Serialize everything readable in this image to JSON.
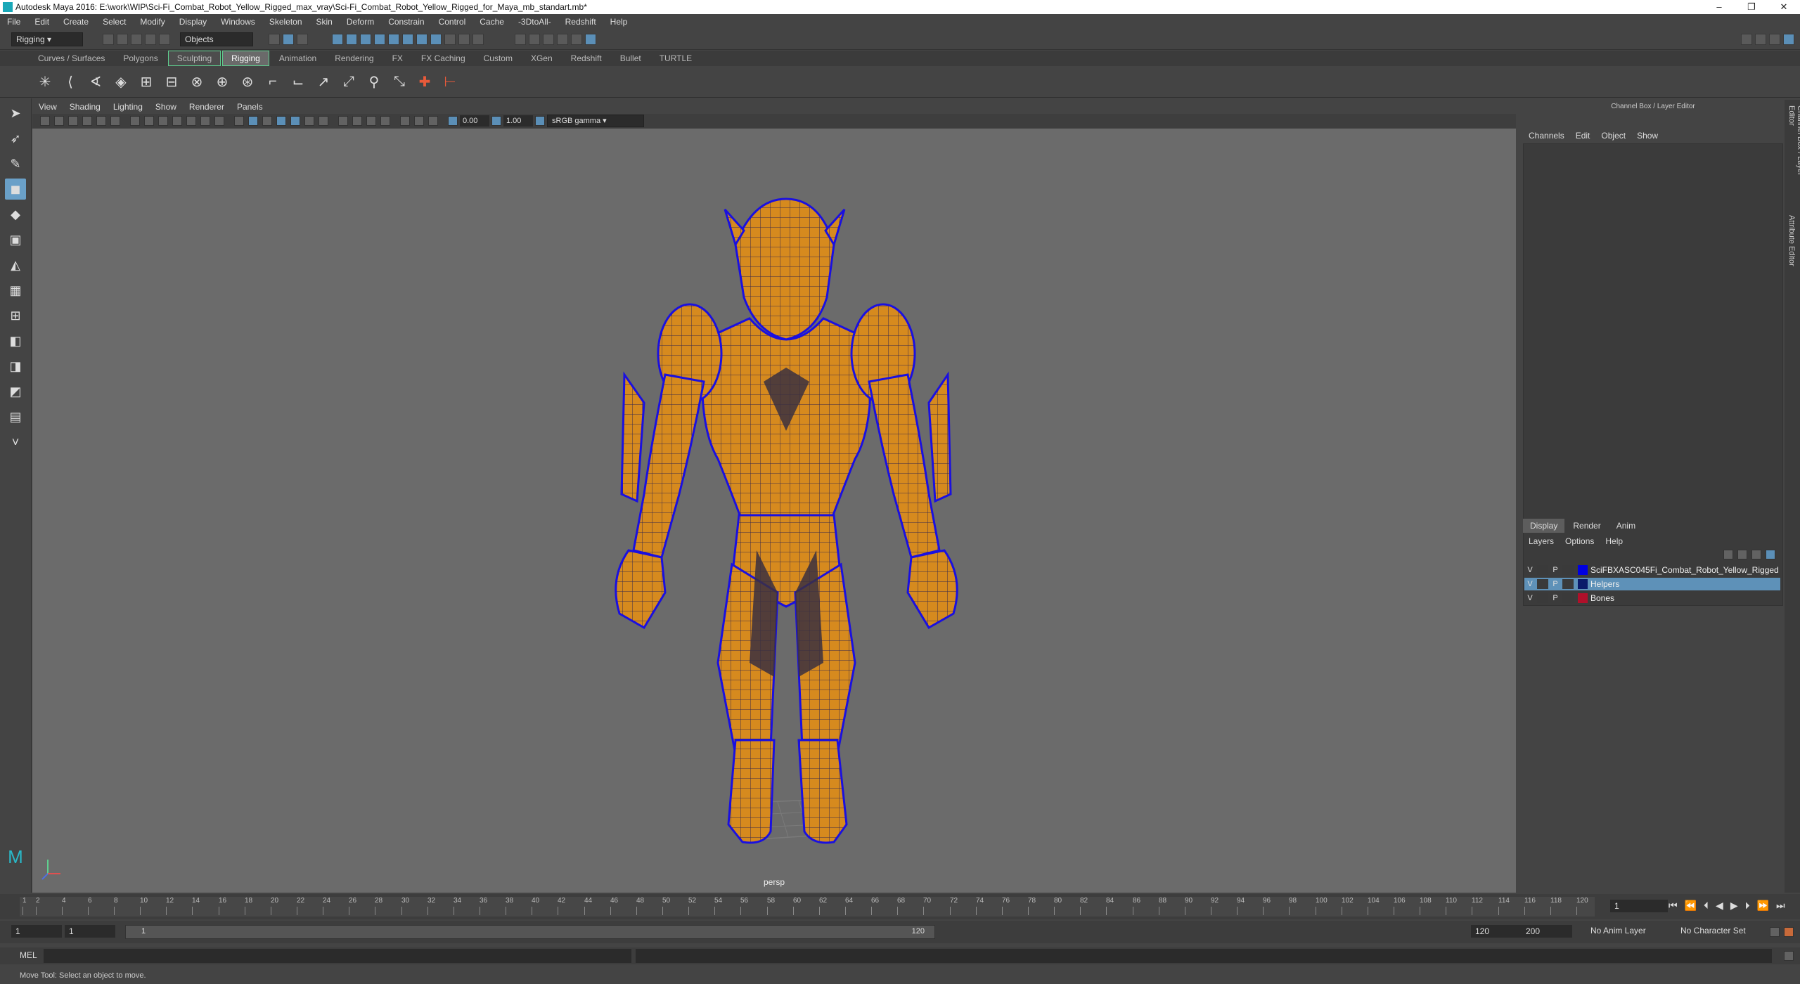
{
  "window": {
    "title": "Autodesk Maya 2016: E:\\work\\WIP\\Sci-Fi_Combat_Robot_Yellow_Rigged_max_vray\\Sci-Fi_Combat_Robot_Yellow_Rigged_for_Maya_mb_standart.mb*",
    "minimize": "–",
    "restore": "❐",
    "close": "✕"
  },
  "menubar": [
    "File",
    "Edit",
    "Create",
    "Select",
    "Modify",
    "Display",
    "Windows",
    "Skeleton",
    "Skin",
    "Deform",
    "Constrain",
    "Control",
    "Cache",
    "-3DtoAll-",
    "Redshift",
    "Help"
  ],
  "statusline": {
    "menuset": "Rigging",
    "selection_mode": "Objects"
  },
  "shelf_tabs": [
    "Curves / Surfaces",
    "Polygons",
    "Sculpting",
    "Rigging",
    "Animation",
    "Rendering",
    "FX",
    "FX Caching",
    "Custom",
    "XGen",
    "Redshift",
    "Bullet",
    "TURTLE"
  ],
  "active_shelf": "Rigging",
  "viewport": {
    "menu": [
      "View",
      "Shading",
      "Lighting",
      "Show",
      "Renderer",
      "Panels"
    ],
    "exposure": "0.00",
    "gamma": "1.00",
    "color_space": "sRGB gamma",
    "camera_label": "persp"
  },
  "channel_box": {
    "header": "Channel Box / Layer Editor",
    "menu": [
      "Channels",
      "Edit",
      "Object",
      "Show"
    ]
  },
  "layer_editor": {
    "tabs": [
      "Display",
      "Render",
      "Anim"
    ],
    "active_tab": "Display",
    "menu": [
      "Layers",
      "Options",
      "Help"
    ],
    "layers": [
      {
        "v": "V",
        "p": "P",
        "color": "#0000e0",
        "name": "SciFBXASC045Fi_Combat_Robot_Yellow_Rigged",
        "selected": false
      },
      {
        "v": "V",
        "p": "P",
        "color": "#0a1a6a",
        "name": "Helpers",
        "selected": true
      },
      {
        "v": "V",
        "p": "P",
        "color": "#b0102a",
        "name": "Bones",
        "selected": false
      }
    ]
  },
  "side_tabs": [
    "Channel Box / Layer Editor",
    "Attribute Editor"
  ],
  "timeline": {
    "ticks": [
      "1",
      "2",
      "4",
      "6",
      "8",
      "10",
      "12",
      "14",
      "16",
      "18",
      "20",
      "22",
      "24",
      "26",
      "28",
      "30",
      "32",
      "34",
      "36",
      "38",
      "40",
      "42",
      "44",
      "46",
      "48",
      "50",
      "52",
      "54",
      "56",
      "58",
      "60",
      "62",
      "64",
      "66",
      "68",
      "70",
      "72",
      "74",
      "76",
      "78",
      "80",
      "82",
      "84",
      "86",
      "88",
      "90",
      "92",
      "94",
      "96",
      "98",
      "100",
      "102",
      "104",
      "106",
      "108",
      "110",
      "112",
      "114",
      "116",
      "118",
      "120"
    ],
    "current_frame": "1"
  },
  "range": {
    "start": "1",
    "playback_start": "1",
    "slider_start": "1",
    "slider_end": "120",
    "playback_end": "120",
    "end": "200",
    "anim_layer": "No Anim Layer",
    "character_set": "No Character Set"
  },
  "command": {
    "lang": "MEL"
  },
  "help_line": "Move Tool: Select an object to move."
}
